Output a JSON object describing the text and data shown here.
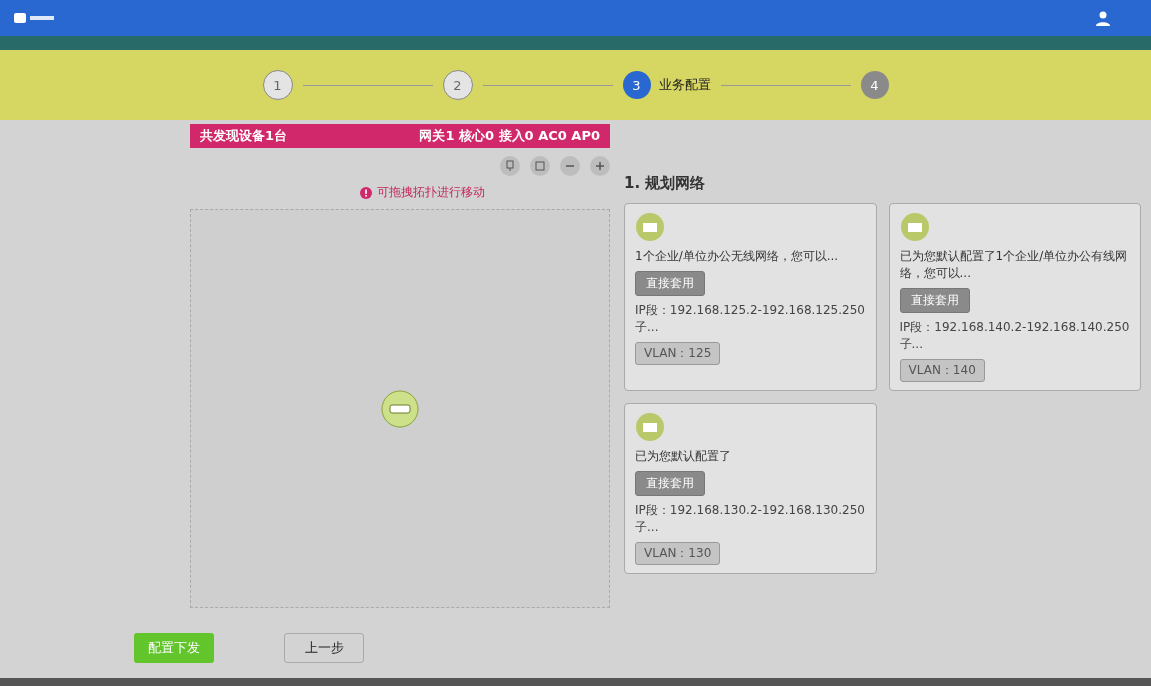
{
  "steps": [
    {
      "number": "1",
      "done": true,
      "selected": false
    },
    {
      "number": "2",
      "done": true,
      "selected": false
    },
    {
      "number": "3",
      "done": false,
      "selected": true,
      "label": "业务配置"
    },
    {
      "number": "4",
      "done": false,
      "selected": false
    }
  ],
  "topology": {
    "summary": "共发现设备1台",
    "counts": "网关1 核心0 接入0 AC0 AP0",
    "hint": "可拖拽拓扑进行移动"
  },
  "section_title": "1. 规划网络",
  "networks": [
    {
      "description": "1个企业/单位办公无线网络，您可以...",
      "apply": "直接套用",
      "ip": "IP段：192.168.125.2-192.168.125.250子...",
      "vlan": "VLAN：125"
    },
    {
      "description": "已为您默认配置了1个企业/单位办公有线网络，您可以...",
      "apply": "直接套用",
      "ip": "IP段：192.168.140.2-192.168.140.250子...",
      "vlan": "VLAN：140"
    },
    {
      "description": "已为您默认配置了",
      "apply": "直接套用",
      "ip": "IP段：192.168.130.2-192.168.130.250子...",
      "vlan": "VLAN：130"
    }
  ],
  "buttons": [
    {
      "label": "配置下发",
      "kind": "primary"
    },
    {
      "label": "上一步",
      "kind": "secondary"
    }
  ]
}
